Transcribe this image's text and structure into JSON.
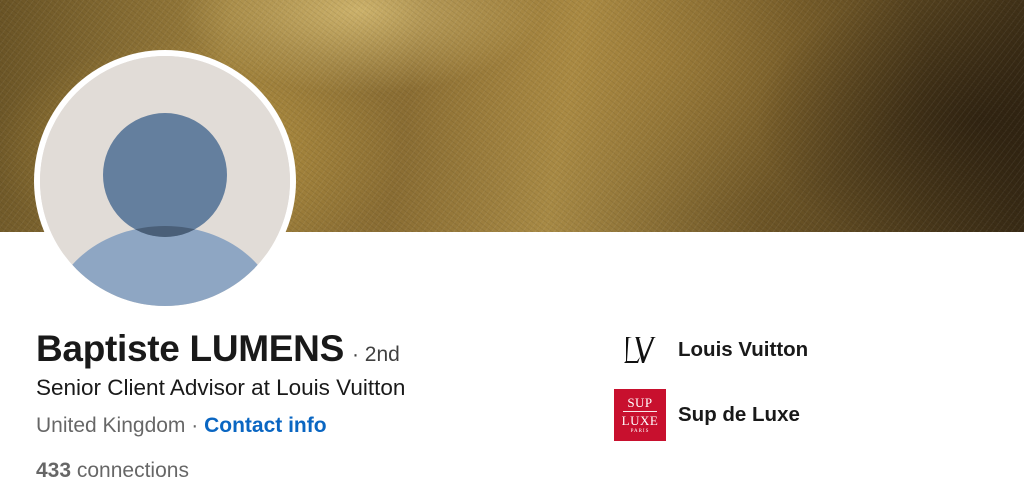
{
  "profile": {
    "name": "Baptiste LUMENS",
    "degree": "· 2nd",
    "headline": "Senior Client Advisor at Louis Vuitton",
    "location": "United Kingdom",
    "location_separator": " · ",
    "contact_info": "Contact info",
    "connections_count": "433",
    "connections_label": " connections"
  },
  "companies": [
    {
      "name": "Louis Vuitton",
      "logo_text": "LV"
    },
    {
      "name": "Sup de Luxe",
      "logo_text": {
        "line1": "SUP",
        "line2": "LUXE",
        "line3": "PARIS"
      }
    }
  ],
  "colors": {
    "link": "#0a66c2",
    "avatar_bg": "#e1dcd7",
    "avatar_head": "#647f9e",
    "avatar_body": "#8ea6c3",
    "sup_red": "#c8102e"
  },
  "icons": {
    "avatar": "default-person-avatar-icon",
    "lv": "louis-vuitton-logo",
    "sup": "sup-de-luxe-logo"
  }
}
